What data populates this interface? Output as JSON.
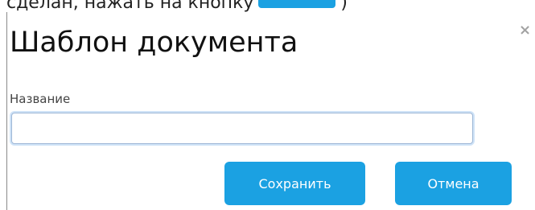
{
  "background": {
    "text_before": "сделан, нажать на кнопку",
    "text_after": ")"
  },
  "dialog": {
    "close_glyph": "×",
    "title": "Шаблон документа",
    "name_field": {
      "label": "Название",
      "value": ""
    },
    "buttons": {
      "save": "Сохранить",
      "cancel": "Отмена"
    }
  },
  "colors": {
    "accent": "#1ba1e2",
    "close_icon": "#a3a3a3",
    "input_focus": "#cfe3f7"
  }
}
